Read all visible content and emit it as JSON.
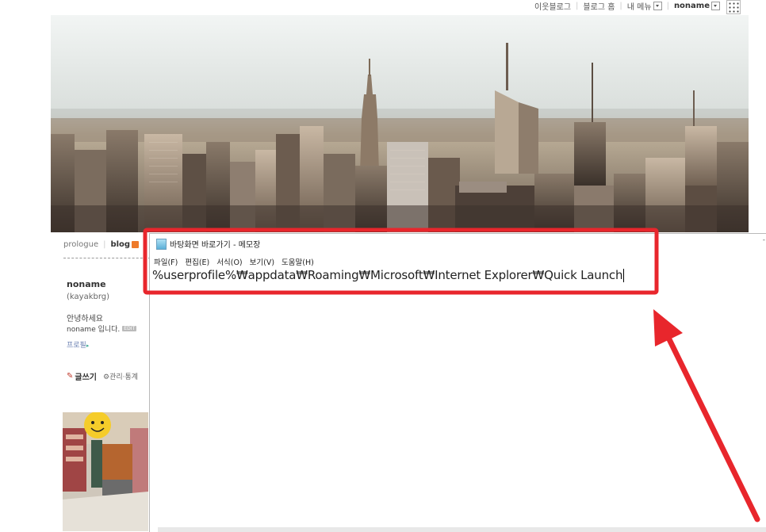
{
  "top_nav": {
    "links": [
      "이웃블로그",
      "블로그 홈",
      "내 메뉴"
    ],
    "user": "noname"
  },
  "blog_menu": {
    "items": [
      "prologue",
      "blog"
    ]
  },
  "profile": {
    "name": "noname",
    "id": "(kayakbrg)",
    "greeting_line1": "안녕하세요",
    "greeting_line2": "noname 입니다.",
    "edit_badge": "EDIT",
    "profile_link": "프로필",
    "write_label": "글쓰기",
    "manage_label": "관리·통계"
  },
  "notepad": {
    "title": "바탕화면 바로가기 - 메모장",
    "menu": [
      "파일(F)",
      "편집(E)",
      "서식(O)",
      "보기(V)",
      "도움말(H)"
    ],
    "content": "%userprofile%₩appdata₩Roaming₩Microsoft₩Internet Explorer₩Quick Launch"
  },
  "colors": {
    "highlight": "#e8262c",
    "link": "#6a7fb1",
    "rss": "#ee7a2a"
  },
  "icons": {
    "grid": "grid-menu-icon",
    "notepad": "notepad-icon",
    "rss": "rss-icon",
    "pencil": "pencil-icon",
    "gear": "gear-icon"
  }
}
